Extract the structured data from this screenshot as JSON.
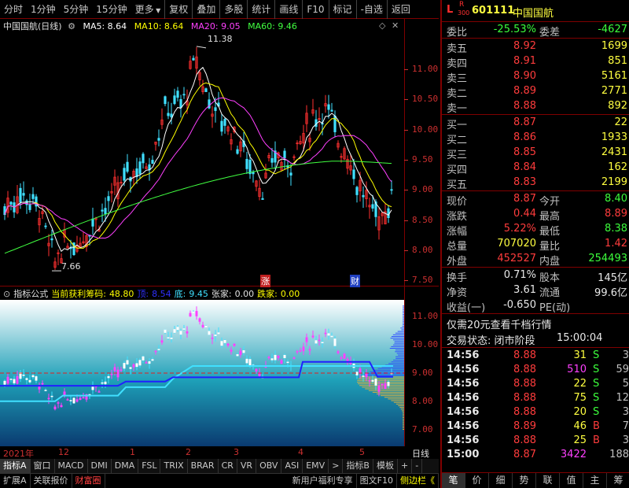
{
  "toolbar": {
    "periods": [
      "分时",
      "1分钟",
      "5分钟",
      "15分钟",
      "更多"
    ],
    "actions": [
      "复权",
      "叠加",
      "多股",
      "统计",
      "画线",
      "F10",
      "标记",
      "-自选",
      "返回"
    ]
  },
  "chart": {
    "stock_name": "中国国航",
    "period": "(日线)",
    "ma5_label": "MA5: 8.64",
    "ma10_label": "MA10: 8.64",
    "ma20_label": "MA20: 9.05",
    "ma60_label": "MA60: 9.46",
    "high_marker": "11.38",
    "low_marker": "7.66",
    "price_ticks": [
      "11.00",
      "10.50",
      "10.00",
      "9.50",
      "9.00",
      "8.50",
      "8.00",
      "7.50"
    ],
    "badges": [
      "涨",
      "财"
    ],
    "colors": {
      "ma5": "#ffffff",
      "ma10": "#ffff00",
      "ma20": "#ff40ff",
      "ma60": "#40ff40",
      "up": "#ff3030",
      "down": "#40e0ff"
    }
  },
  "indicator": {
    "name": "指标公式",
    "profit_label": "当前获利筹码:",
    "profit_value": "48.80",
    "top_label": "顶:",
    "top_value": "8.54",
    "bottom_label": "底:",
    "bottom_value": "9.45",
    "zhang_label": "张家:",
    "zhang_value": "0.00",
    "die_label": "跌家:",
    "die_value": "0.00",
    "ticks": [
      "11.00",
      "10.00",
      "9.00",
      "8.00",
      "7.00"
    ]
  },
  "dates": {
    "year": "2021年",
    "months": [
      "12",
      "1",
      "2",
      "3",
      "4",
      "5"
    ],
    "mode": "日线"
  },
  "tabs": [
    "指标A",
    "窗口",
    "MACD",
    "DMI",
    "DMA",
    "FSL",
    "TRIX",
    "BRAR",
    "CR",
    "VR",
    "OBV",
    "ASI",
    "EMV",
    ">",
    "指标B",
    "模板",
    "+",
    "-"
  ],
  "bottom": [
    "扩展A",
    "关联报价",
    "财富圈",
    "新用户福利专享",
    "图文F10",
    "侧边栏《"
  ],
  "quote": {
    "code": "601111",
    "name": "中国国航",
    "mark_l": "L",
    "mark_r": "R",
    "mark_num": "300",
    "weibi_label": "委比",
    "weibi": "-25.53%",
    "weicha_label": "委差",
    "weicha": "-4627",
    "sells": [
      {
        "label": "卖五",
        "price": "8.92",
        "vol": "1699"
      },
      {
        "label": "卖四",
        "price": "8.91",
        "vol": "851"
      },
      {
        "label": "卖三",
        "price": "8.90",
        "vol": "5161"
      },
      {
        "label": "卖二",
        "price": "8.89",
        "vol": "2771"
      },
      {
        "label": "卖一",
        "price": "8.88",
        "vol": "892"
      }
    ],
    "buys": [
      {
        "label": "买一",
        "price": "8.87",
        "vol": "22"
      },
      {
        "label": "买二",
        "price": "8.86",
        "vol": "1933"
      },
      {
        "label": "买三",
        "price": "8.85",
        "vol": "2431"
      },
      {
        "label": "买四",
        "price": "8.84",
        "vol": "162"
      },
      {
        "label": "买五",
        "price": "8.83",
        "vol": "2199"
      }
    ],
    "stats": [
      {
        "l1": "现价",
        "v1": "8.87",
        "l2": "今开",
        "v2": "8.40",
        "c1": "red",
        "c2": "grn"
      },
      {
        "l1": "涨跌",
        "v1": "0.44",
        "l2": "最高",
        "v2": "8.89",
        "c1": "red",
        "c2": "red"
      },
      {
        "l1": "涨幅",
        "v1": "5.22%",
        "l2": "最低",
        "v2": "8.38",
        "c1": "red",
        "c2": "grn"
      },
      {
        "l1": "总量",
        "v1": "707020",
        "l2": "量比",
        "v2": "1.42",
        "c1": "yel",
        "c2": "red"
      },
      {
        "l1": "外盘",
        "v1": "452527",
        "l2": "内盘",
        "v2": "254493",
        "c1": "red",
        "c2": "grn"
      }
    ],
    "stats2": [
      {
        "l1": "换手",
        "v1": "0.71%",
        "l2": "股本",
        "v2": "145亿"
      },
      {
        "l1": "净资",
        "v1": "3.61",
        "l2": "流通",
        "v2": "99.6亿"
      },
      {
        "l1": "收益(一)",
        "v1": "-0.650",
        "l2": "PE(动)",
        "v2": ""
      }
    ],
    "promo": "仅需20元查看千档行情",
    "status_label": "交易状态: 闭市阶段",
    "status_time": "15:00:04",
    "ticks": [
      {
        "t": "14:56",
        "p": "8.88",
        "v": "31",
        "bs": "S",
        "n": "3",
        "vc": "yel",
        "bc": "grn"
      },
      {
        "t": "14:56",
        "p": "8.88",
        "v": "510",
        "bs": "S",
        "n": "59",
        "vc": "mag",
        "bc": "grn"
      },
      {
        "t": "14:56",
        "p": "8.88",
        "v": "22",
        "bs": "S",
        "n": "5",
        "vc": "yel",
        "bc": "grn"
      },
      {
        "t": "14:56",
        "p": "8.88",
        "v": "75",
        "bs": "S",
        "n": "12",
        "vc": "yel",
        "bc": "grn"
      },
      {
        "t": "14:56",
        "p": "8.88",
        "v": "20",
        "bs": "S",
        "n": "3",
        "vc": "yel",
        "bc": "grn"
      },
      {
        "t": "14:56",
        "p": "8.89",
        "v": "46",
        "bs": "B",
        "n": "7",
        "vc": "yel",
        "bc": "red"
      },
      {
        "t": "14:56",
        "p": "8.88",
        "v": "25",
        "bs": "B",
        "n": "3",
        "vc": "yel",
        "bc": "red"
      },
      {
        "t": "15:00",
        "p": "8.87",
        "v": "3422",
        "bs": "",
        "n": "188",
        "vc": "mag",
        "bc": "red"
      }
    ],
    "side_tabs": [
      "笔",
      "价",
      "细",
      "势",
      "联",
      "值",
      "主",
      "筹"
    ]
  }
}
